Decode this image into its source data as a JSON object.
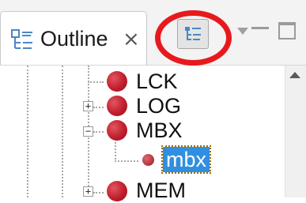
{
  "view": {
    "tab_label": "Outline",
    "tab_close_glyph": "⨯",
    "icons": {
      "tab": "outline-view-icon",
      "toolbar_button": "hierarchy-tree-icon",
      "menu": "view-menu-triangle-icon",
      "minimize": "minimize-icon",
      "maximize": "maximize-icon",
      "scroll_up": "scroll-up-arrow-icon"
    },
    "highlight_color": "#e8191d"
  },
  "tree": {
    "nodes": [
      {
        "label": "LCK",
        "expander": "",
        "icon": "red-ball-icon"
      },
      {
        "label": "LOG",
        "expander": "+",
        "icon": "red-ball-icon"
      },
      {
        "label": "MBX",
        "expander": "−",
        "icon": "red-ball-icon"
      },
      {
        "label": "mbx",
        "expander": "",
        "icon": "small-red-ball-icon",
        "selected": true
      },
      {
        "label": "MEM",
        "expander": "+",
        "icon": "red-ball-icon"
      }
    ],
    "selection_color": "#2f8fe0"
  }
}
